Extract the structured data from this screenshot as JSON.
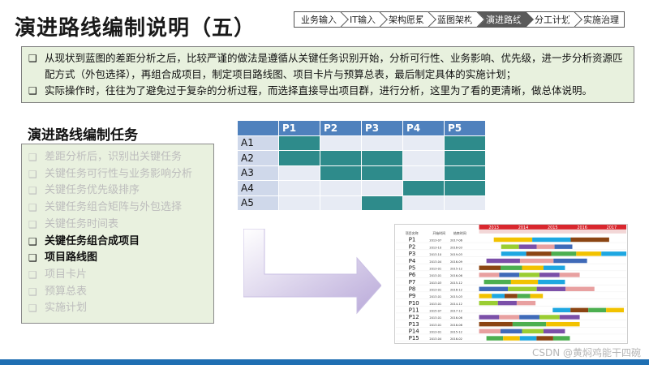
{
  "title": "演进路线编制说明（五）",
  "steps": [
    {
      "label": "业务输入",
      "active": false
    },
    {
      "label": "IT输入",
      "active": false
    },
    {
      "label": "架构愿景",
      "active": false
    },
    {
      "label": "蓝图架构",
      "active": false
    },
    {
      "label": "演进路线",
      "active": true
    },
    {
      "label": "分工计划",
      "active": false
    },
    {
      "label": "实施治理",
      "active": false
    }
  ],
  "intro": [
    "从现状到蓝图的差距分析之后，比较严谨的做法是遵循从关键任务识别开始，分析可行性、业务影响、优先级，进一步分析资源匹配方式（外包选择），再组合成项目，制定项目路线图、项目卡片与预算总表，最后制定具体的实施计划；",
    "实际操作时，往往为了避免过于复杂的分析过程，而选择直接导出项目群，进行分析，这里为了看的更清晰，做总体说明。"
  ],
  "tasks_title": "演进路线编制任务",
  "tasks": [
    {
      "label": "差距分析后，识别出关键任务",
      "active": false
    },
    {
      "label": "关键任务可行性与业务影响分析",
      "active": false
    },
    {
      "label": "关键任务优先级排序",
      "active": false
    },
    {
      "label": "关键任务组合矩阵与外包选择",
      "active": false
    },
    {
      "label": "关键任务时间表",
      "active": false
    },
    {
      "label": "关键任务组合成项目",
      "active": true
    },
    {
      "label": "项目路线图",
      "active": true
    },
    {
      "label": "项目卡片",
      "active": false
    },
    {
      "label": "预算总表",
      "active": false
    },
    {
      "label": "实施计划",
      "active": false
    }
  ],
  "grid": {
    "cols": [
      "P1",
      "P2",
      "P3",
      "P4",
      "P5"
    ],
    "rows": [
      {
        "label": "A1",
        "cells": [
          1,
          0,
          0,
          0,
          1
        ]
      },
      {
        "label": "A2",
        "cells": [
          1,
          1,
          1,
          0,
          1
        ]
      },
      {
        "label": "A3",
        "cells": [
          0,
          1,
          1,
          0,
          1
        ]
      },
      {
        "label": "A4",
        "cells": [
          0,
          0,
          0,
          1,
          1
        ]
      },
      {
        "label": "A5",
        "cells": [
          0,
          0,
          1,
          0,
          0
        ]
      }
    ]
  },
  "timeline": {
    "years": [
      "2013",
      "2014",
      "2015",
      "2016",
      "2017"
    ],
    "col_headers": [
      "项目名称",
      "开始时间",
      "结束时间"
    ],
    "projects": [
      {
        "name": "P1",
        "start": "2013-07",
        "end": "2017-06"
      },
      {
        "name": "P2",
        "start": "2013-10",
        "end": "2016-03"
      },
      {
        "name": "P3",
        "start": "2013-10",
        "end": "2019-03"
      },
      {
        "name": "P4",
        "start": "2013-04",
        "end": "2016-09"
      },
      {
        "name": "P5",
        "start": "2013-01",
        "end": "2015-12"
      },
      {
        "name": "P6",
        "start": "2013-01",
        "end": "2016-06"
      },
      {
        "name": "P7",
        "start": "2013-03",
        "end": "2015-12"
      },
      {
        "name": "P8",
        "start": "2013-01",
        "end": "2016-12"
      },
      {
        "name": "P9",
        "start": "2013-01",
        "end": "2015-03"
      },
      {
        "name": "P10",
        "start": "2013-01",
        "end": "2014-12"
      },
      {
        "name": "P11",
        "start": "2015-07",
        "end": "2017-12"
      },
      {
        "name": "P12",
        "start": "2013-01",
        "end": "2016-06"
      },
      {
        "name": "P13",
        "start": "2013-01",
        "end": "2016-06"
      },
      {
        "name": "P14",
        "start": "2013-01",
        "end": "2015-12"
      },
      {
        "name": "P15",
        "start": "2013-04",
        "end": "2016-02"
      }
    ]
  },
  "watermark": "CSDN @黄焖鸡能干四碗",
  "colors": {
    "grid_fill": "#2e8b8b",
    "grid_header": "#4f81bd",
    "intro_bg": "#e8f1de",
    "timeline_year_band": "#d9262d",
    "bottom_bar": "#1f6fb2"
  }
}
